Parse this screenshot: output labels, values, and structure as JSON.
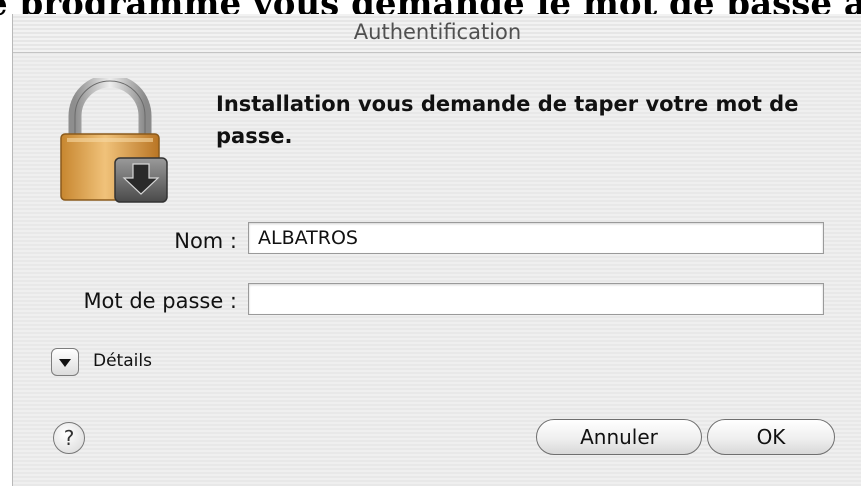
{
  "background": {
    "heading": "e programme vous demande le mot de passe admi"
  },
  "dialog": {
    "title": "Authentification",
    "message": "Installation vous demande de taper votre mot de passe.",
    "name_label": "Nom :",
    "name_value": "ALBATROS",
    "password_label": "Mot de passe :",
    "password_value": "",
    "details_label": "Détails",
    "help_label": "?",
    "cancel_label": "Annuler",
    "ok_label": "OK"
  },
  "icons": {
    "lock": "padlock-with-install-arrow-icon",
    "disclosure": "triangle-down-icon",
    "help": "question-icon"
  }
}
